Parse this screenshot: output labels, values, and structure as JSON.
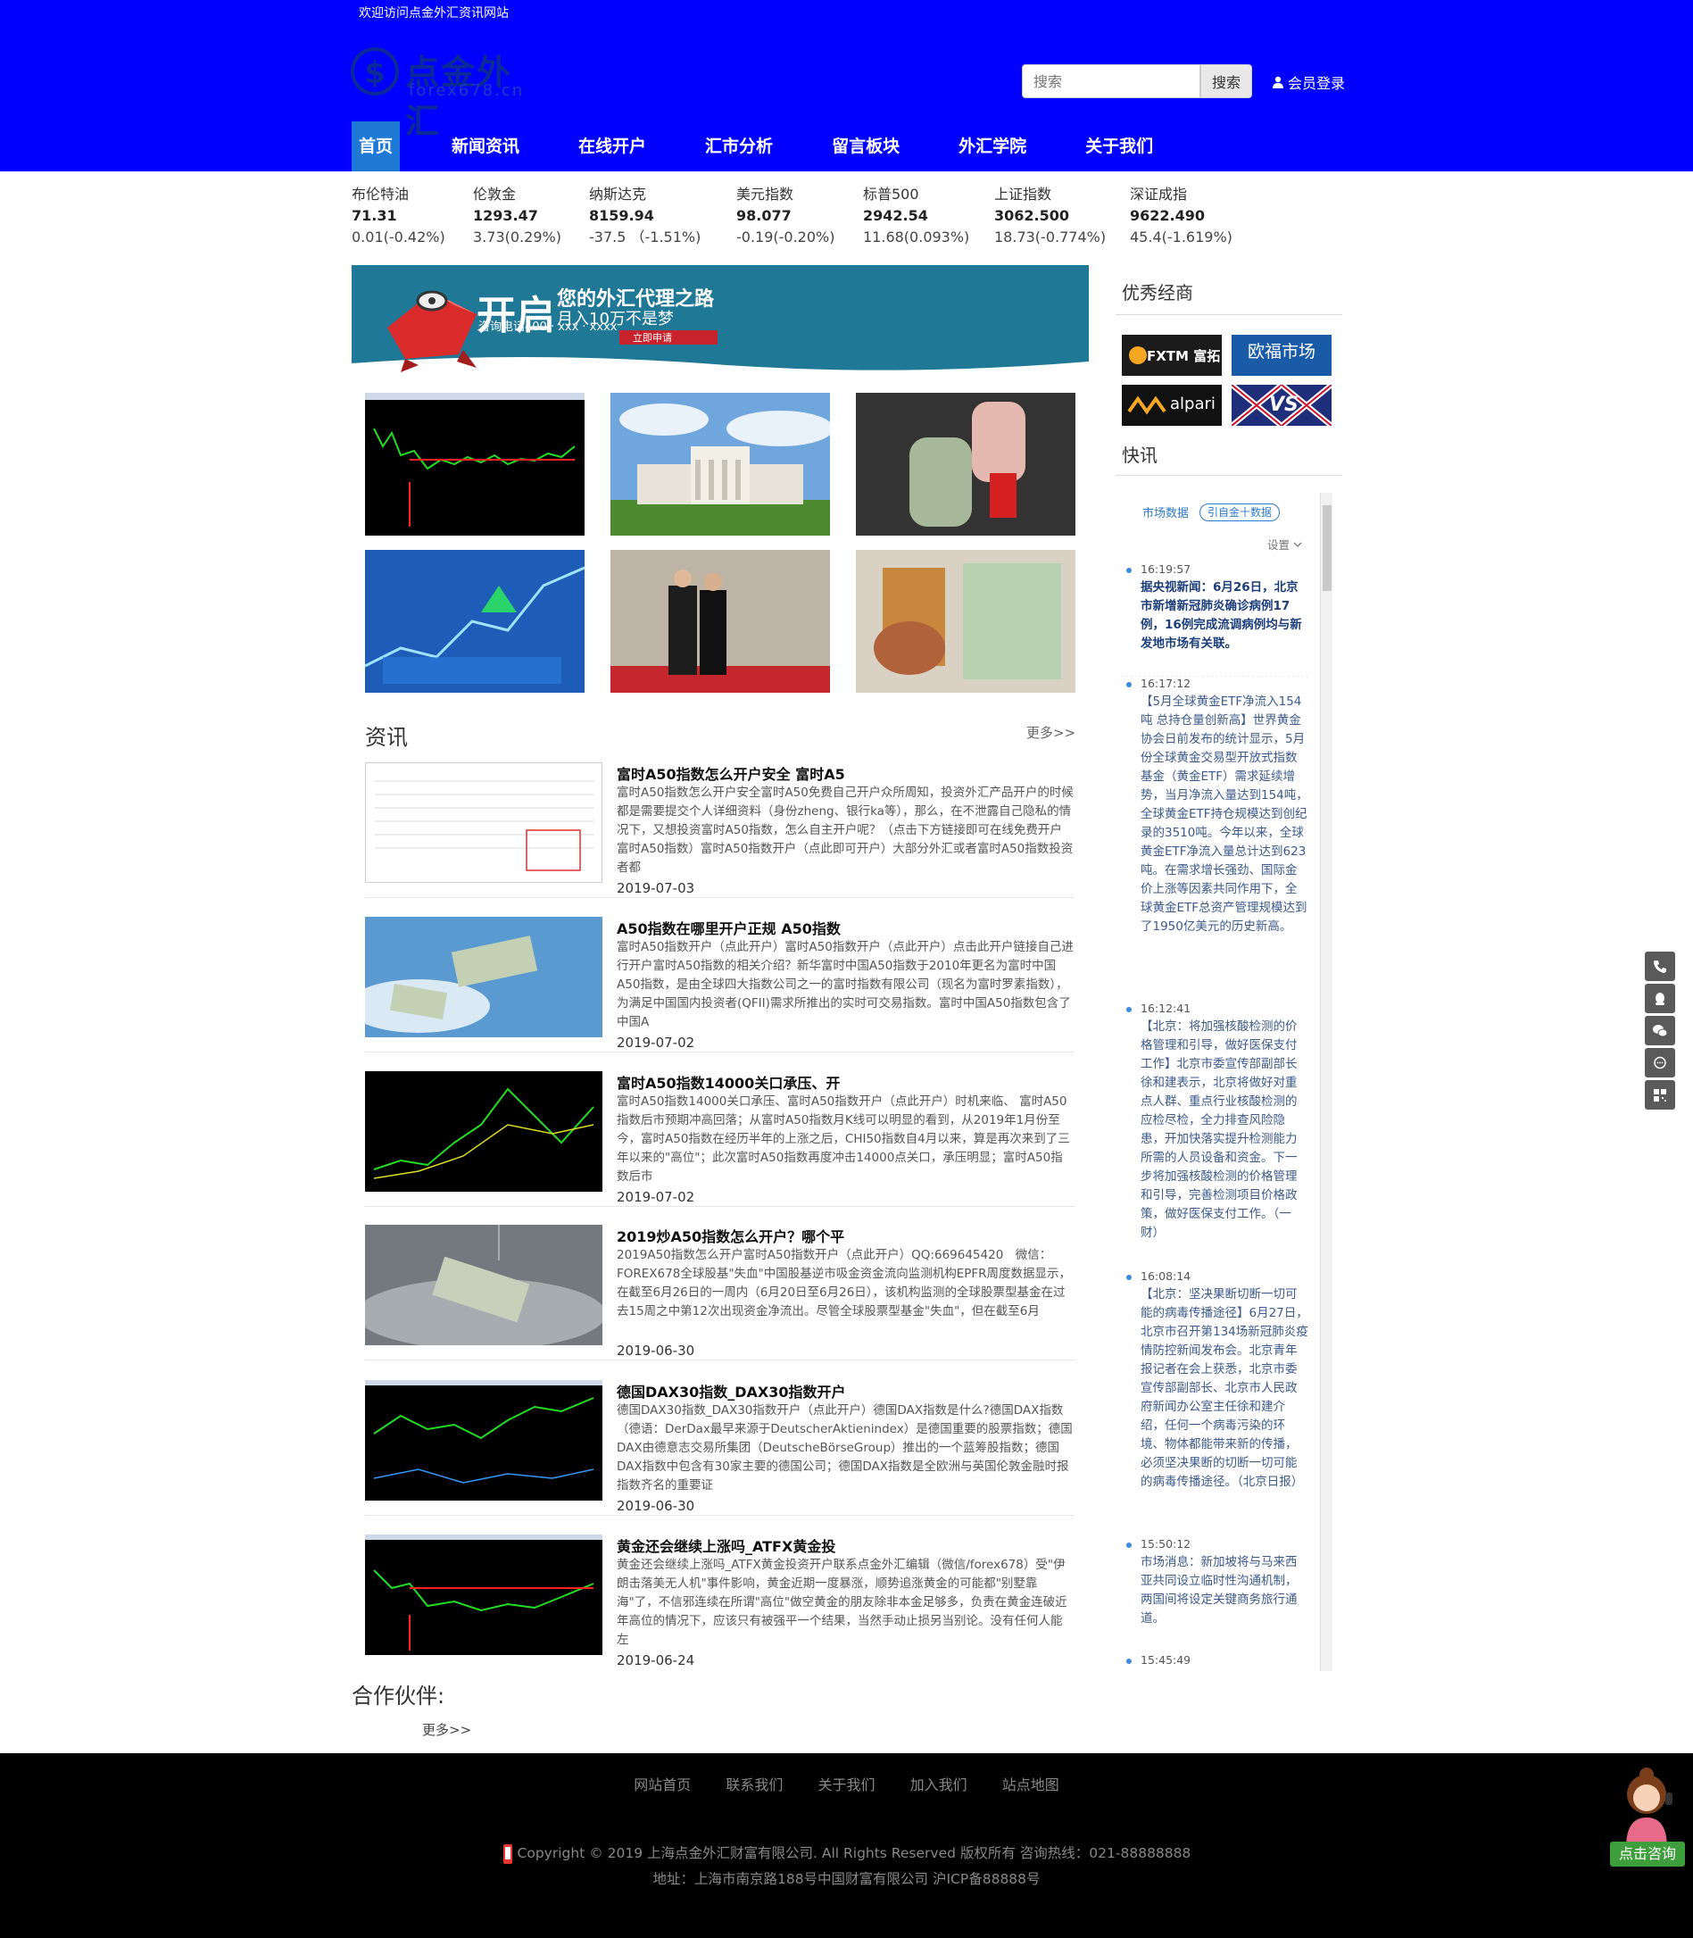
{
  "header": {
    "welcome": "欢迎访问点金外汇资讯网站",
    "logo_brand": "点金外汇",
    "logo_domain": "forex678.cn",
    "search_placeholder": "搜索",
    "search_button": "搜索",
    "login": "会员登录",
    "nav": [
      "首页",
      "新闻资讯",
      "在线开户",
      "汇市分析",
      "留言板块",
      "外汇学院",
      "关于我们"
    ],
    "bg_color": "#0000ff",
    "active_nav_color": "#1e78d6"
  },
  "ticker": [
    {
      "name": "布伦特油",
      "price": "71.31",
      "change": "0.01(-0.42%)"
    },
    {
      "name": "伦敦金",
      "price": "1293.47",
      "change": "3.73(0.29%)"
    },
    {
      "name": "纳斯达克",
      "price": "8159.94",
      "change": "-37.5 （-1.51%)"
    },
    {
      "name": "美元指数",
      "price": "98.077",
      "change": "-0.19(-0.20%)"
    },
    {
      "name": "标普500",
      "price": "2942.54",
      "change": "11.68(0.093%)"
    },
    {
      "name": "上证指数",
      "price": "3062.500",
      "change": "18.73(-0.774%)"
    },
    {
      "name": "深证成指",
      "price": "9622.490",
      "change": "45.4(-1.619%)"
    }
  ],
  "banner": {
    "headline": "开启",
    "tagline": "您的外汇代理之路",
    "sub": "月入10万不是梦",
    "phone": "咨询电话400 · xxx · xxxx",
    "apply": "立即申请"
  },
  "news": {
    "title": "资讯",
    "more": "更多>>",
    "items": [
      {
        "title": "富时A50指数怎么开户安全 富时A5",
        "summary": "富时A50指数怎么开户安全富时A50免费自己开户众所周知，投资外汇产品开户的时候都是需要提交个人详细资料（身份zheng、银行ka等），那么，在不泄露自己隐私的情况下，又想投资富时A50指数，怎么自主开户呢？（点击下方链接即可在线免费开户富时A50指数）富时A50指数开户（点此即可开户）大部分外汇或者富时A50指数投资者都",
        "date": "2019-07-03"
      },
      {
        "title": "A50指数在哪里开户正规 A50指数",
        "summary": "富时A50指数开户（点此开户）富时A50指数开户（点此开户）点击此开户链接自己进行开户富时A50指数的相关介绍？新华富时中国A50指数于2010年更名为富时中国A50指数，是由全球四大指数公司之一的富时指数有限公司（现名为富时罗素指数），为满足中国国内投资者(QFII)需求所推出的实时可交易指数。富时中国A50指数包含了中国A",
        "date": "2019-07-02"
      },
      {
        "title": "富时A50指数14000关口承压、开",
        "summary": "富时A50指数14000关口承压、富时A50指数开户（点此开户）时机来临、 富时A50指数后市预期冲高回落；从富时A50指数月K线可以明显的看到，从2019年1月份至今，富时A50指数在经历半年的上涨之后，CHI50指数自4月以来，算是再次来到了三年以来的\"高位\"；此次富时A50指数再度冲击14000点关口，承压明显；富时A50指数后市",
        "date": "2019-07-02"
      },
      {
        "title": "2019炒A50指数怎么开户？哪个平",
        "summary": "2019A50指数怎么开户富时A50指数开户（点此开户）QQ:669645420　微信：FOREX678全球股基\"失血\"中国股基逆市吸金资金流向监测机构EPFR周度数据显示，在截至6月26日的一周内（6月20日至6月26日），该机构监测的全球股票型基金在过去15周之中第12次出现资金净流出。尽管全球股票型基金\"失血\"，但在截至6月",
        "date": "2019-06-30"
      },
      {
        "title": "德国DAX30指数_DAX30指数开户",
        "summary": "德国DAX30指数_DAX30指数开户（点此开户）德国DAX指数是什么?德国DAX指数（德语：DerDax最早来源于DeutscherAktienindex）是德国重要的股票指数；德国DAX由德意志交易所集团（DeutscheBörseGroup）推出的一个蓝筹股指数；德国DAX指数中包含有30家主要的德国公司；德国DAX指数是全欧洲与英国伦敦金融时报指数齐名的重要证",
        "date": "2019-06-30"
      },
      {
        "title": "黄金还会继续上涨吗_ATFX黄金投",
        "summary": "黄金还会继续上涨吗_ATFX黄金投资开户联系点金外汇编辑（微信/forex678）受\"伊朗击落美无人机\"事件影响，黄金近期一度暴涨，顺势追涨黄金的可能都\"别墅靠海\"了，不信邪连续在所谓\"高位\"做空黄金的朋友除非本金足够多，负责在黄金连破近年高位的情况下，应该只有被强平一个结果，当然手动止损另当别论。没有任何人能左",
        "date": "2019-06-24"
      }
    ]
  },
  "partners": {
    "title": "合作伙伴:",
    "more": "更多>>"
  },
  "sidebar": {
    "brokers_title": "优秀经商",
    "brokers": [
      "FXTM 富拓",
      "欧福市场",
      "alpari",
      "VS"
    ],
    "flash_title": "快讯",
    "tabs": [
      "市场数据",
      "引自金十数据"
    ],
    "settings": "设置",
    "flash": [
      {
        "time": "16:19:57",
        "text": "据央视新闻：6月26日，北京市新增新冠肺炎确诊病例17例，16例完成流调病例均与新发地市场有关联。",
        "bold": true
      },
      {
        "time": "16:17:12",
        "text": "【5月全球黄金ETF净流入154吨 总持仓量创新高】世界黄金协会日前发布的统计显示，5月份全球黄金交易型开放式指数基金（黄金ETF）需求延续增势，当月净流入量达到154吨，全球黄金ETF持仓规模达到创纪录的3510吨。今年以来，全球黄金ETF净流入量总计达到623吨。在需求增长强劲、国际金价上涨等因素共同作用下，全球黄金ETF总资产管理规模达到了1950亿美元的历史新高。",
        "bold": false
      },
      {
        "time": "16:12:41",
        "text": "【北京：将加强核酸检测的价格管理和引导，做好医保支付工作】北京市委宣传部副部长徐和建表示，北京将做好对重点人群、重点行业核酸检测的应检尽检，全力排查风险隐患，开加快落实提升检测能力所需的人员设备和资金。下一步将加强核酸检测的价格管理和引导，完善检测项目价格政策，做好医保支付工作。（一财）",
        "bold": false
      },
      {
        "time": "16:08:14",
        "text": "【北京：坚决果断切断一切可能的病毒传播途径】6月27日，北京市召开第134场新冠肺炎疫情防控新闻发布会。北京青年报记者在会上获悉，北京市委宣传部副部长、北京市人民政府新闻办公室主任徐和建介绍，任何一个病毒污染的环境、物体都能带来新的传播，必须坚决果断的切断一切可能的病毒传播途径。（北京日报）",
        "bold": false
      },
      {
        "time": "15:50:12",
        "text": "市场消息：新加坡将与马来西亚共同设立临时性沟通机制，两国间将设定关键商务旅行通道。",
        "bold": false
      },
      {
        "time": "15:45:49",
        "text": "",
        "bold": false
      }
    ]
  },
  "footer": {
    "links": [
      "网站首页",
      "联系我们",
      "关于我们",
      "加入我们",
      "站点地图"
    ],
    "copyright": "Copyright © 2019 上海点金外汇财富有限公司. All Rights Reserved 版权所有 咨询热线：021-88888888",
    "address": "地址：上海市南京路188号中国财富有限公司 沪ICP备88888号",
    "consult": "点击咨询"
  }
}
